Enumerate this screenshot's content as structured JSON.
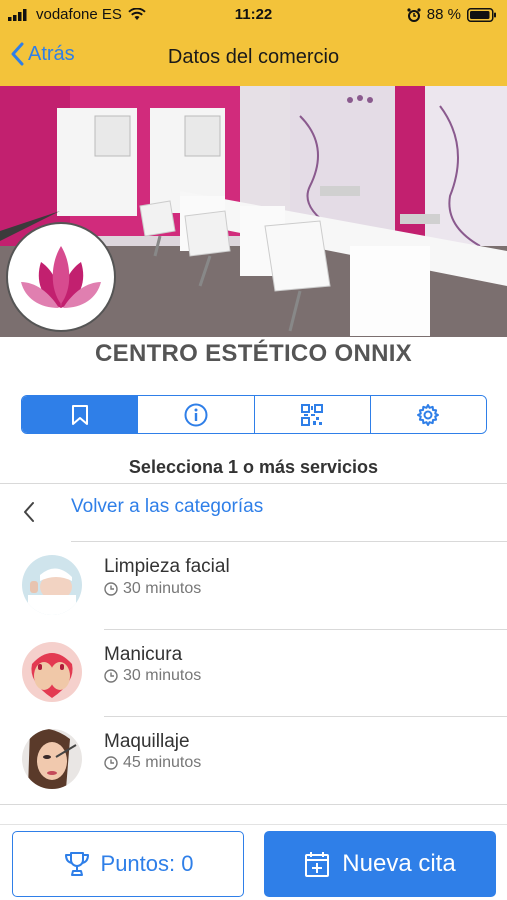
{
  "status_bar": {
    "carrier": "vodafone ES",
    "time": "11:22",
    "battery": "88 %"
  },
  "nav": {
    "back_label": "Atrás",
    "title": "Datos del comercio"
  },
  "business": {
    "name": "CENTRO ESTÉTICO ONNIX"
  },
  "tabs": [
    {
      "icon": "bookmark-icon",
      "active": true
    },
    {
      "icon": "info-icon",
      "active": false
    },
    {
      "icon": "qr-code-icon",
      "active": false
    },
    {
      "icon": "gear-icon",
      "active": false
    }
  ],
  "services_section": {
    "title": "Selecciona 1 o más servicios",
    "back_to_categories": "Volver a las categorías",
    "items": [
      {
        "name": "Limpieza facial",
        "duration": "30 minutos"
      },
      {
        "name": "Manicura",
        "duration": "30 minutos"
      },
      {
        "name": "Maquillaje",
        "duration": "45 minutos"
      }
    ]
  },
  "bottom": {
    "points_label": "Puntos: 0",
    "new_appointment_label": "Nueva cita"
  },
  "colors": {
    "header": "#f3c33a",
    "accent": "#2f7fe8",
    "brand_magenta": "#c2206f"
  }
}
